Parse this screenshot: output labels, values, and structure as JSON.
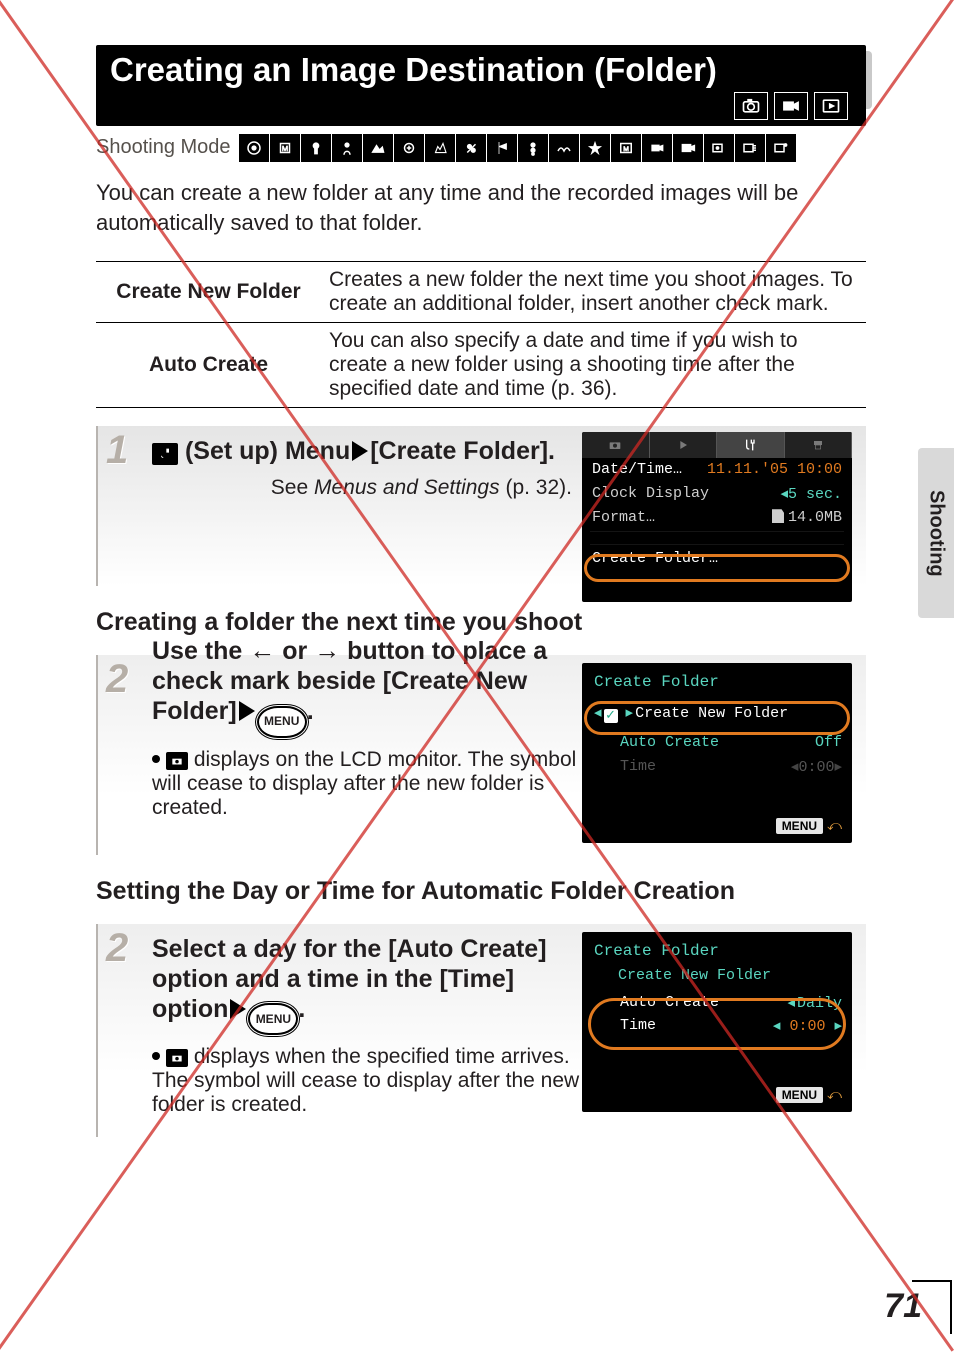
{
  "title": "Creating an Image Destination (Folder)",
  "shootingModeLabel": "Shooting Mode",
  "intro": "You can create a new folder at any time and the recorded images will be automatically saved to that folder.",
  "table": {
    "row1": {
      "label": "Create New Folder",
      "desc": "Creates a new folder the next time you shoot images. To create an additional folder, insert another check mark."
    },
    "row2": {
      "label": "Auto Create",
      "desc": "You can also specify a date and time if you wish to create a new folder using a shooting time after the specified date and time (p. 36)."
    }
  },
  "step1": {
    "num": "1",
    "head_a": "(Set up) Menu",
    "head_b": "[Create Folder].",
    "sub_a": "See ",
    "sub_em": "Menus and Settings",
    "sub_b": " (p. 32).",
    "screen": {
      "dateTimeLabel": "Date/Time…",
      "dateTimeVal": "11.11.'05 10:00",
      "clockLabel": "Clock Display",
      "clockVal": "5 sec.",
      "formatLabel": "Format…",
      "formatVal": "14.0MB",
      "createFolder": "Create Folder…"
    }
  },
  "sectionA": "Creating a folder the next time you shoot",
  "step2a": {
    "num": "2",
    "head_a": "Use the ",
    "head_b": " or ",
    "head_c": " button to place a check mark beside [Create New Folder]",
    "head_d": ".",
    "menuLabel": "MENU",
    "sub": " displays on the LCD monitor. The symbol will cease to display after the new folder is created.",
    "screen": {
      "title": "Create Folder",
      "row1": "Create New Folder",
      "row2a": "Auto Create",
      "row2b": "Off",
      "row3a": "Time",
      "row3b": "0:00",
      "menu": "MENU"
    }
  },
  "sectionB": "Setting the Day or Time for Automatic Folder Creation",
  "step2b": {
    "num": "2",
    "head_a": "Select a day for the [Auto Create] option and a time in the [Time] option",
    "head_b": ".",
    "menuLabel": "MENU",
    "sub": " displays when the specified time arrives. The symbol will cease to display after the new folder is created.",
    "screen": {
      "title": "Create Folder",
      "row1": "Create New Folder",
      "row2a": "Auto Create",
      "row2b": "Daily",
      "row3a": "Time",
      "row3b": "0:00",
      "menu": "MENU"
    }
  },
  "sideTab": "Shooting",
  "pageNumber": "71",
  "chart_data": null
}
